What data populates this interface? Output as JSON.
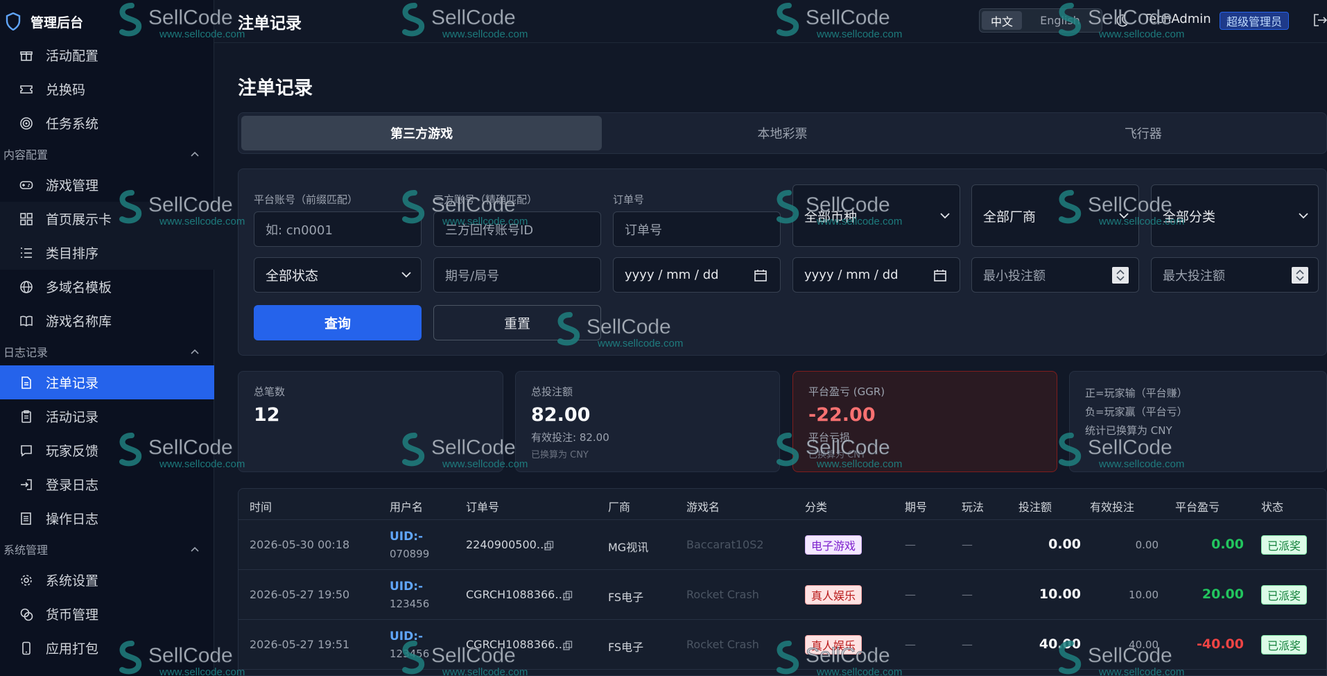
{
  "brand": {
    "title": "管理后台"
  },
  "sidebar": {
    "items_top": [
      {
        "label": "活动配置",
        "icon": "gift-icon"
      },
      {
        "label": "兑换码",
        "icon": "ticket-icon"
      },
      {
        "label": "任务系统",
        "icon": "target-icon"
      }
    ],
    "group_content": "内容配置",
    "items_content": [
      {
        "label": "游戏管理",
        "icon": "gamepad-icon"
      },
      {
        "label": "首页展示卡",
        "icon": "grid-icon"
      },
      {
        "label": "类目排序",
        "icon": "list-ordered-icon"
      },
      {
        "label": "多域名模板",
        "icon": "globe-icon"
      },
      {
        "label": "游戏名称库",
        "icon": "book-icon"
      }
    ],
    "group_logs": "日志记录",
    "items_logs": [
      {
        "label": "注单记录",
        "icon": "file-text-icon"
      },
      {
        "label": "活动记录",
        "icon": "clipboard-icon"
      },
      {
        "label": "玩家反馈",
        "icon": "message-icon"
      },
      {
        "label": "登录日志",
        "icon": "login-icon"
      },
      {
        "label": "操作日志",
        "icon": "log-icon"
      }
    ],
    "group_system": "系统管理",
    "items_system": [
      {
        "label": "系统设置",
        "icon": "gear-icon"
      },
      {
        "label": "货币管理",
        "icon": "coins-icon"
      },
      {
        "label": "应用打包",
        "icon": "phone-icon"
      }
    ]
  },
  "header": {
    "title": "注单记录",
    "lang_zh": "中文",
    "lang_en": "English",
    "user": "TechAdmin",
    "role": "超级管理员"
  },
  "page": {
    "title": "注单记录",
    "tabs": [
      "第三方游戏",
      "本地彩票",
      "飞行器"
    ]
  },
  "filters": {
    "platform_label": "平台账号（前缀匹配）",
    "platform_placeholder": "如: cn0001",
    "third_label": "三方账号（精确匹配）",
    "third_placeholder": "三方回传账号ID",
    "order_label": "订单号",
    "order_placeholder": "订单号",
    "currency": "全部币种",
    "vendor": "全部厂商",
    "category": "全部分类",
    "status": "全部状态",
    "period_placeholder": "期号/局号",
    "date_start": "yyyy / mm / dd",
    "date_end": "yyyy / mm / dd",
    "min_bet_placeholder": "最小投注额",
    "max_bet_placeholder": "最大投注额",
    "query_button": "查询",
    "reset_button": "重置"
  },
  "stats": {
    "count_label": "总笔数",
    "count_value": "12",
    "bet_label": "总投注额",
    "bet_value": "82.00",
    "bet_valid": "有效投注: 82.00",
    "bet_cny": "已换算为 CNY",
    "ggr_label": "平台盈亏 (GGR)",
    "ggr_value": "-22.00",
    "ggr_sub": "平台亏损",
    "ggr_cny": "已换算为 CNY",
    "note1": "正=玩家输（平台赚）",
    "note2": "负=玩家赢（平台亏）",
    "note3": "统计已换算为 CNY"
  },
  "table": {
    "headers": [
      "时间",
      "用户名",
      "订单号",
      "厂商",
      "游戏名",
      "分类",
      "期号",
      "玩法",
      "投注额",
      "有效投注",
      "平台盈亏",
      "状态"
    ],
    "rows": [
      {
        "time": "2026-05-30 00:18",
        "uid_a": "UID:-",
        "uid_b": "070899",
        "order": "2240900500…",
        "vendor": "MG视讯",
        "game": "Baccarat10S2",
        "category": "电子游戏",
        "period": "—",
        "play": "—",
        "bet": "0.00",
        "valid": "0.00",
        "ggr": "0.00",
        "status": "已派奖"
      },
      {
        "time": "2026-05-27 19:50",
        "uid_a": "UID:-",
        "uid_b": "123456",
        "order": "CGRCH1088366…",
        "vendor": "FS电子",
        "game": "Rocket Crash",
        "category": "真人娱乐",
        "period": "—",
        "play": "—",
        "bet": "10.00",
        "valid": "10.00",
        "ggr": "20.00",
        "status": "已派奖"
      },
      {
        "time": "2026-05-27 19:51",
        "uid_a": "UID:-",
        "uid_b": "123456",
        "order": "CGRCH1088366…",
        "vendor": "FS电子",
        "game": "Rocket Crash",
        "category": "真人娱乐",
        "period": "—",
        "play": "—",
        "bet": "40.00",
        "valid": "40.00",
        "ggr": "-40.00",
        "status": "已派奖"
      }
    ]
  },
  "watermark": {
    "brand": "SellCode",
    "url": "www.sellcode.com"
  }
}
